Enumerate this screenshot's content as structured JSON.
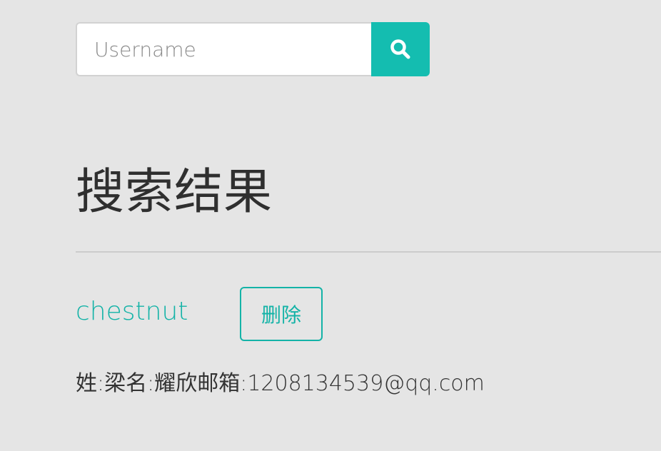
{
  "search": {
    "placeholder": "Username",
    "value": "",
    "button_icon": "search-icon"
  },
  "page_title": "搜索结果",
  "results": [
    {
      "name": "chestnut",
      "delete_label": "删除",
      "detail": "姓:梁名:耀欣邮箱:1208134539@qq.com"
    }
  ],
  "colors": {
    "background": "#e5e5e5",
    "accent": "#14bdb0",
    "divider": "#cccccc"
  }
}
